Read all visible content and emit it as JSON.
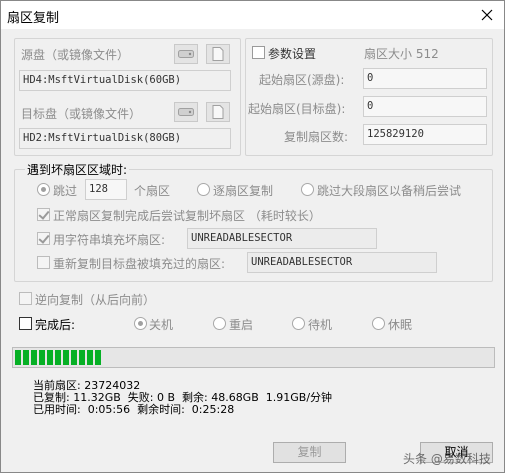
{
  "window": {
    "title": "扇区复制"
  },
  "source": {
    "label": "源盘（或镜像文件）",
    "value": "HD4:MsftVirtualDisk(60GB)"
  },
  "target": {
    "label": "目标盘（或镜像文件）",
    "value": "HD2:MsftVirtualDisk(80GB)"
  },
  "params": {
    "checkbox_label": "参数设置",
    "sector_size_label": "扇区大小 512",
    "start_src_label": "起始扇区(源盘):",
    "start_src_value": "0",
    "start_dst_label": "起始扇区(目标盘):",
    "start_dst_value": "0",
    "copy_count_label": "复制扇区数:",
    "copy_count_value": "125829120"
  },
  "bad_sector": {
    "legend": "遇到坏扇区区域时:",
    "skip_label": "跳过",
    "skip_value": "128",
    "skip_unit": "个扇区",
    "one_by_one": "逐扇区复制",
    "skip_large": "跳过大段扇区以备稍后尝试",
    "retry_label": "正常扇区复制完成后尝试复制坏扇区 （耗时较长）",
    "fill_label": "用字符串填充坏扇区:",
    "fill_value": "UNREADABLESECTOR",
    "recopy_label": "重新复制目标盘被填充过的扇区:",
    "recopy_value": "UNREADABLESECTOR"
  },
  "reverse_label": "逆向复制（从后向前）",
  "after": {
    "label": "完成后:",
    "options": [
      "关机",
      "重启",
      "待机",
      "休眠"
    ]
  },
  "progress": {
    "fraction": 0.18
  },
  "status": {
    "line1": "当前扇区: 23724032",
    "line2": "已复制: 11.32GB  失败: 0 B  剩余: 48.68GB  1.91GB/分钟",
    "line3": "已用时间:  0:05:56  剩余时间:  0:25:28"
  },
  "buttons": {
    "copy": "复制",
    "cancel": "取消"
  },
  "watermark": "头条 @易数科技"
}
